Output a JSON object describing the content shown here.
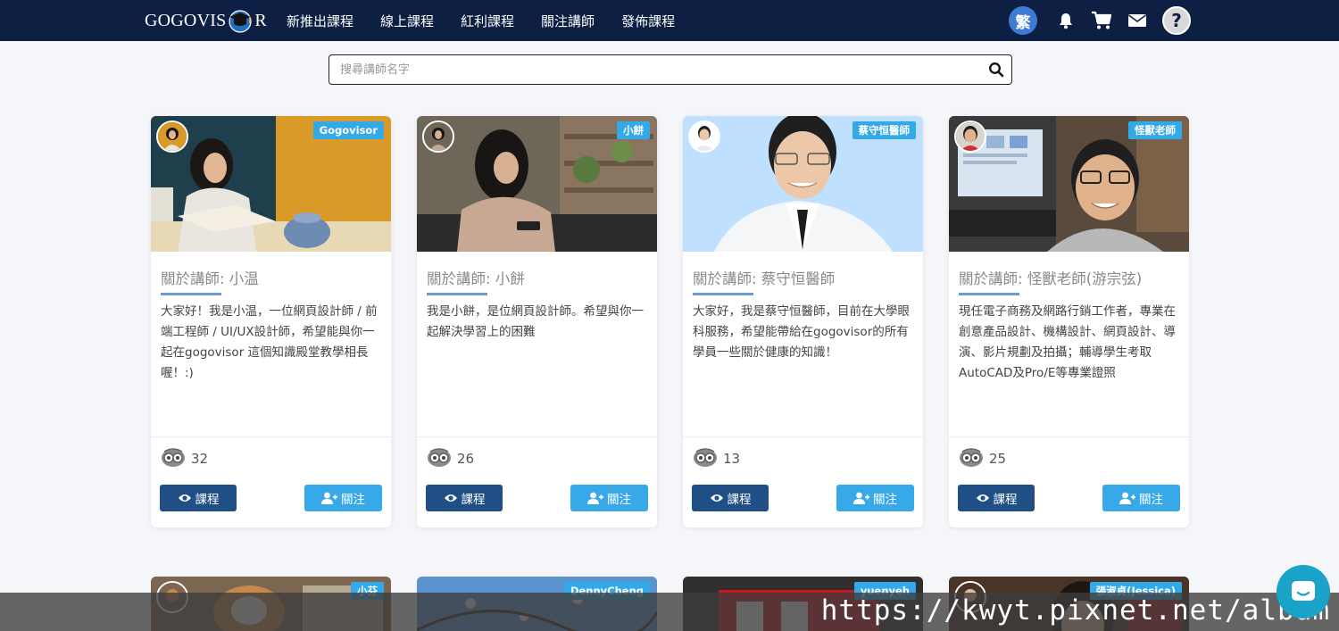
{
  "navbar": {
    "logo_left": "GOGOVIS",
    "logo_right": "R",
    "menu": [
      "新推出課程",
      "線上課程",
      "紅利課程",
      "關注講師",
      "發佈課程"
    ],
    "lang_label": "繁",
    "help_label": "?"
  },
  "search": {
    "placeholder": "搜尋講師名字",
    "value": ""
  },
  "cards": [
    {
      "tag": "Gogovisor",
      "title": "關於講師: 小温",
      "desc": "大家好！我是小温，一位網頁設計師 / 前端工程師 / UI/UX設計師，希望能與你一起在gogovisor 這個知識殿堂教學相長喔！:)",
      "count": "32",
      "course_label": "課程",
      "follow_label": "關注"
    },
    {
      "tag": "小餅",
      "title": "關於講師: 小餅",
      "desc": "我是小餅，是位網頁設計師。希望與你一起解決學習上的困難",
      "count": "26",
      "course_label": "課程",
      "follow_label": "關注"
    },
    {
      "tag": "蔡守恒醫師",
      "title": "關於講師: 蔡守恒醫師",
      "desc": "大家好，我是蔡守恒醫師，目前在大學眼科服務，希望能帶給在gogovisor的所有學員一些關於健康的知識！",
      "count": "13",
      "course_label": "課程",
      "follow_label": "關注"
    },
    {
      "tag": "怪獸老師",
      "title": "關於講師: 怪獸老師(游宗弦)",
      "desc": "現任電子商務及網路行銷工作者，專業在創意產品設計、機構設計、網頁設計、導演、影片規劃及拍攝；輔導學生考取AutoCAD及Pro/E等專業證照",
      "count": "25",
      "course_label": "課程",
      "follow_label": "關注"
    }
  ],
  "cards_row2": [
    {
      "tag": "小芬"
    },
    {
      "tag": "DennyCheng"
    },
    {
      "tag": "yuenyeh"
    },
    {
      "tag": "張淑貞(Jessica)"
    }
  ],
  "watermark": "https://kwyt.pixnet.net/album",
  "colors": {
    "navbar": "#0e1f44",
    "tag": "#34a9e8",
    "course_button": "#1f4f85",
    "follow_button": "#37a9e8",
    "title_underline": "#6d9bd3"
  }
}
